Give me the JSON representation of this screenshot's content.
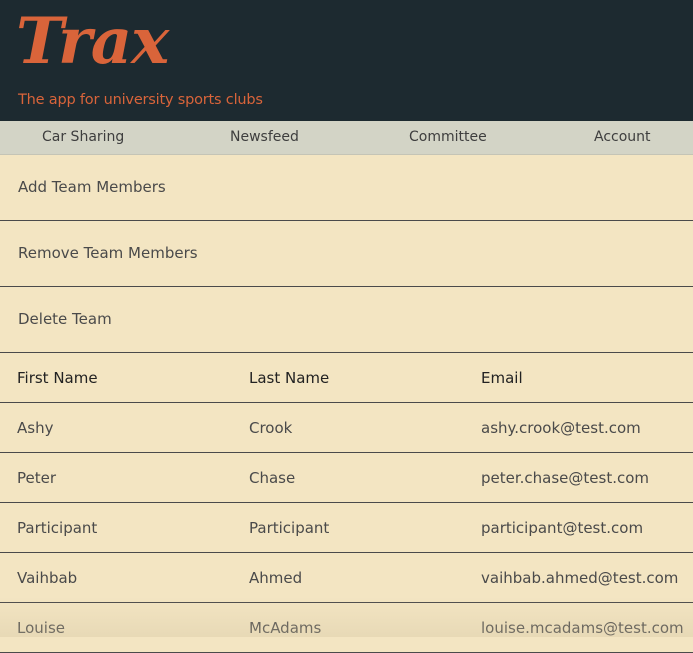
{
  "app": {
    "logo": "Trax",
    "tagline": "The app for university sports clubs",
    "brand_color": "#d9643a",
    "header_bg": "#1d2a30"
  },
  "nav": {
    "items": [
      {
        "label": "Car Sharing"
      },
      {
        "label": "Newsfeed"
      },
      {
        "label": "Committee"
      },
      {
        "label": "Account"
      }
    ]
  },
  "actions": [
    {
      "label": "Add Team Members"
    },
    {
      "label": "Remove Team Members"
    },
    {
      "label": "Delete Team"
    }
  ],
  "table": {
    "headers": [
      "First Name",
      "Last Name",
      "Email"
    ],
    "rows": [
      [
        "Ashy",
        "Crook",
        "ashy.crook@test.com"
      ],
      [
        "Peter",
        "Chase",
        "peter.chase@test.com"
      ],
      [
        "Participant",
        "Participant",
        "participant@test.com"
      ],
      [
        "Vaihbab",
        "Ahmed",
        "vaihbab.ahmed@test.com"
      ],
      [
        "Louise",
        "McAdams",
        "louise.mcadams@test.com"
      ]
    ]
  }
}
